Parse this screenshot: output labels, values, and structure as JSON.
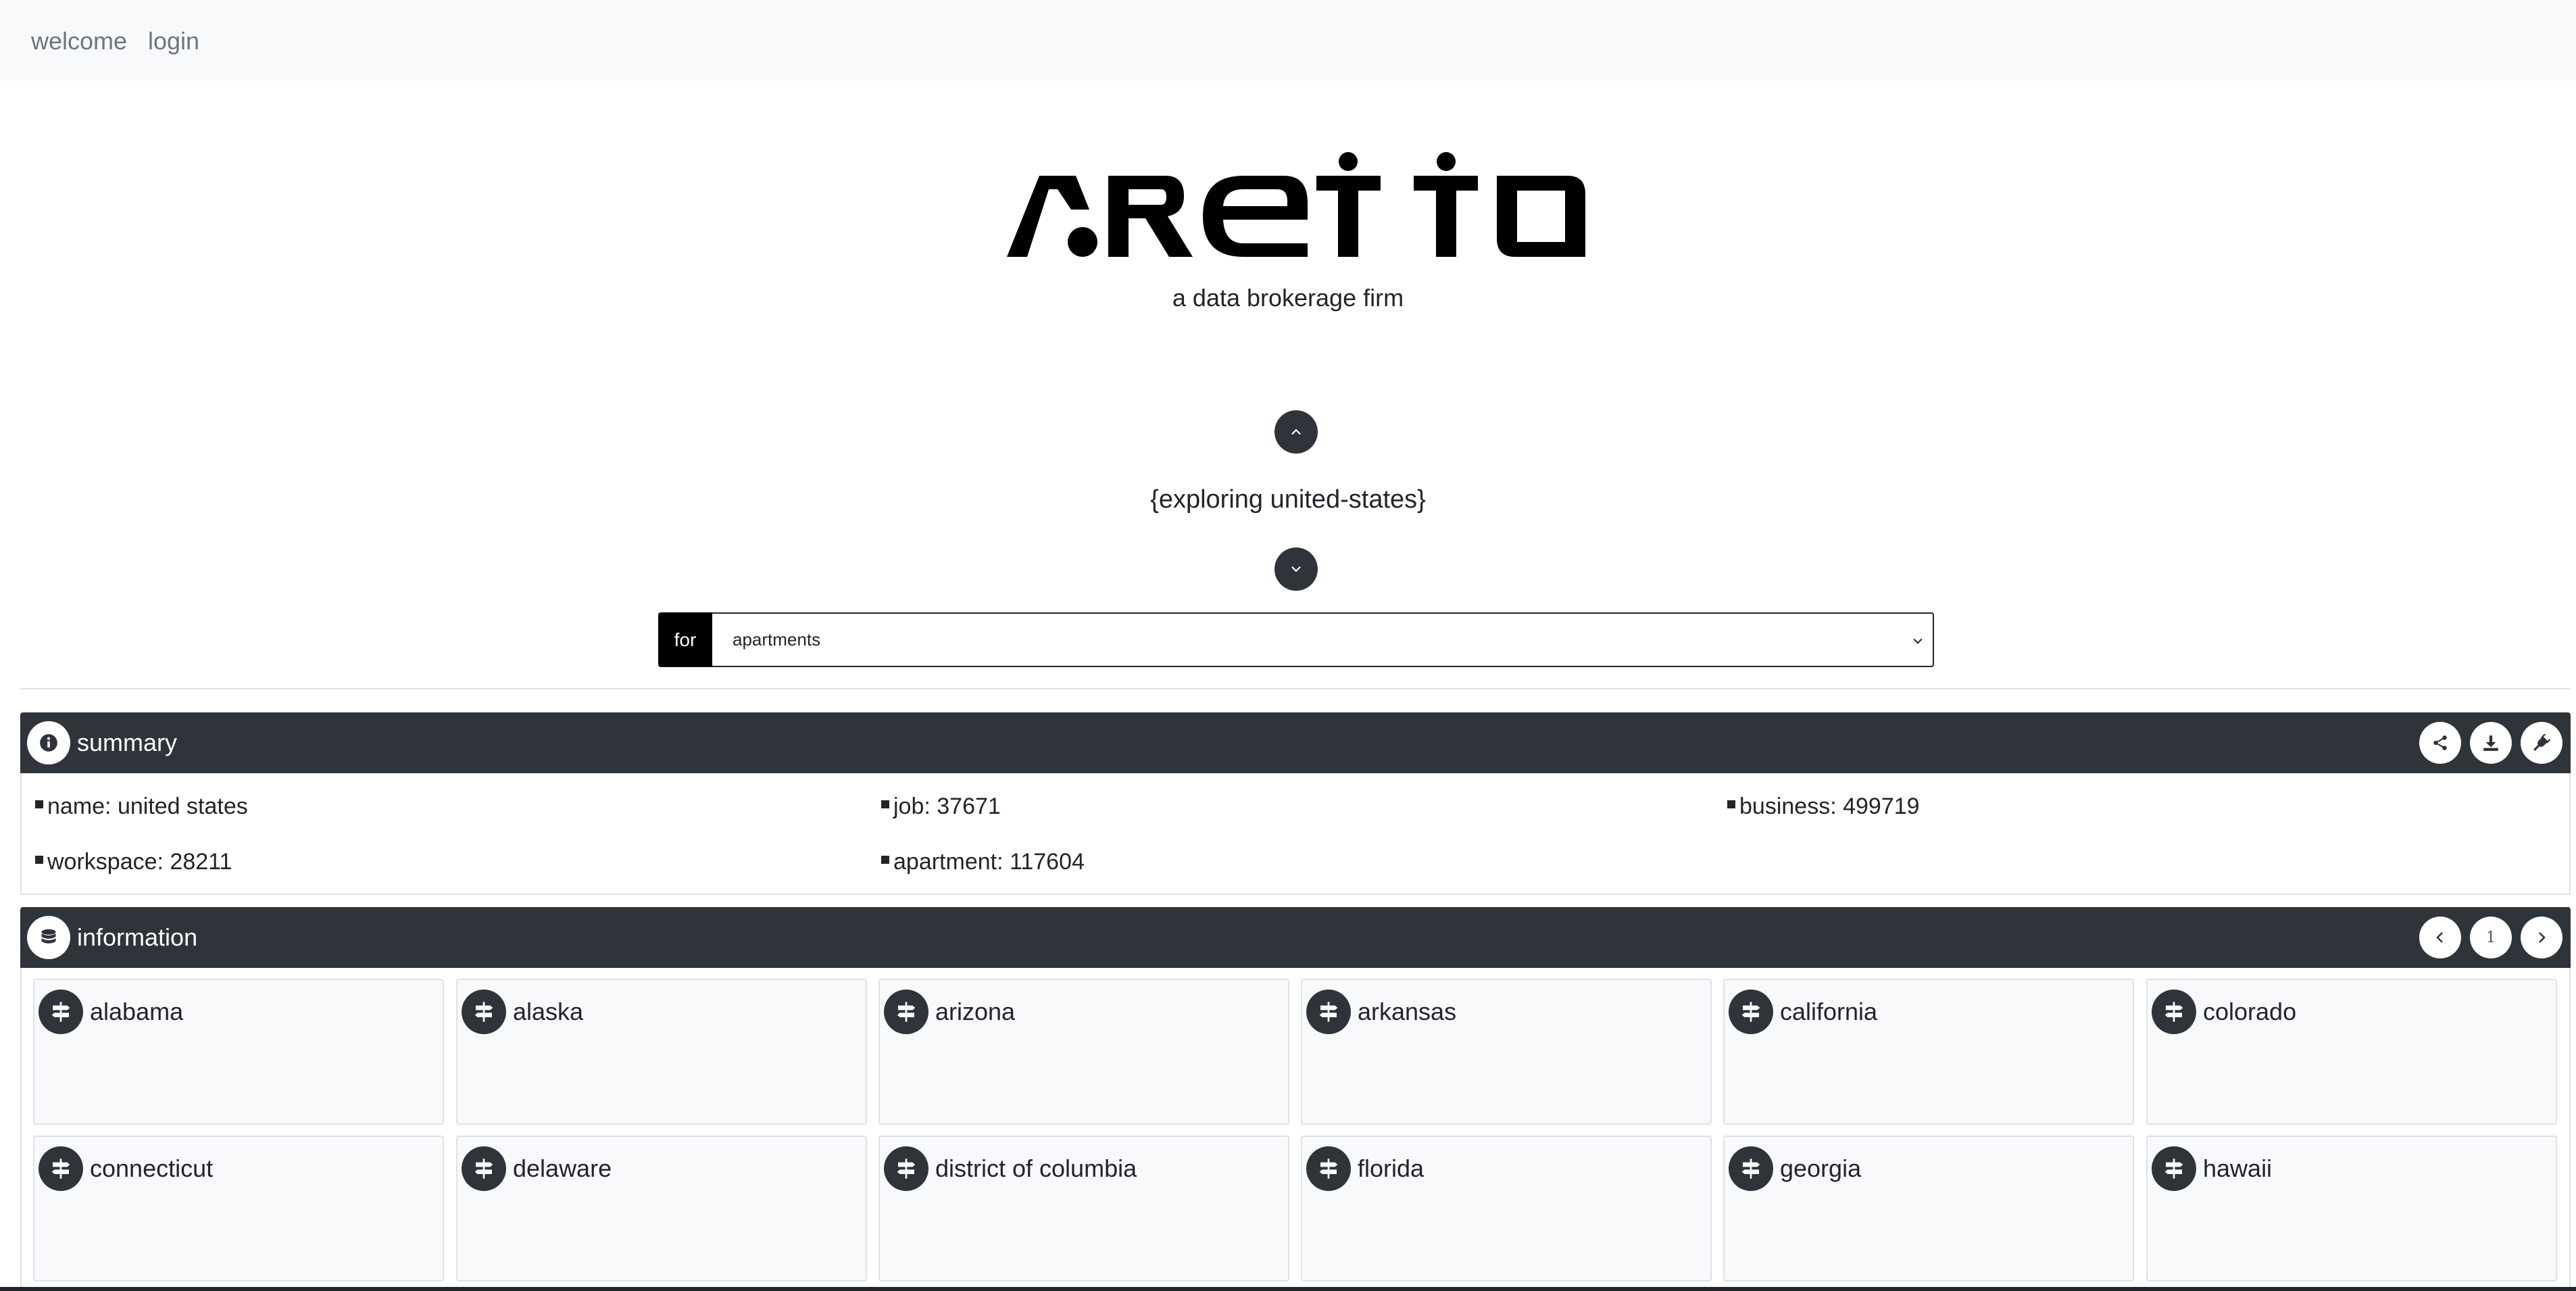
{
  "nav": {
    "welcome": "welcome",
    "login": "login"
  },
  "brand": {
    "logo_text": "aretto",
    "tagline": "a data brokerage firm"
  },
  "explore": {
    "title": "{exploring united-states}"
  },
  "filter": {
    "prefix": "for",
    "selected": "apartments"
  },
  "summary": {
    "title": "summary",
    "items": [
      {
        "label": "name: united states"
      },
      {
        "label": "job: 37671"
      },
      {
        "label": "business: 499719"
      },
      {
        "label": "workspace: 28211"
      },
      {
        "label": "apartment: 117604"
      }
    ]
  },
  "information": {
    "title": "information",
    "page": "1",
    "states": [
      "alabama",
      "alaska",
      "arizona",
      "arkansas",
      "california",
      "colorado",
      "connecticut",
      "delaware",
      "district of columbia",
      "florida",
      "georgia",
      "hawaii"
    ]
  },
  "colors": {
    "dark": "#2f333a",
    "nav_bg": "#f8f9fa",
    "card_bg": "#f8f9fa"
  },
  "icons": {
    "up": "chevron-up-icon",
    "down": "chevron-down-icon",
    "info": "info-icon",
    "share": "share-icon",
    "download": "download-icon",
    "plug": "plug-icon",
    "database": "database-icon",
    "signpost": "signpost-icon",
    "prev": "chevron-left-icon",
    "next": "chevron-right-icon"
  }
}
